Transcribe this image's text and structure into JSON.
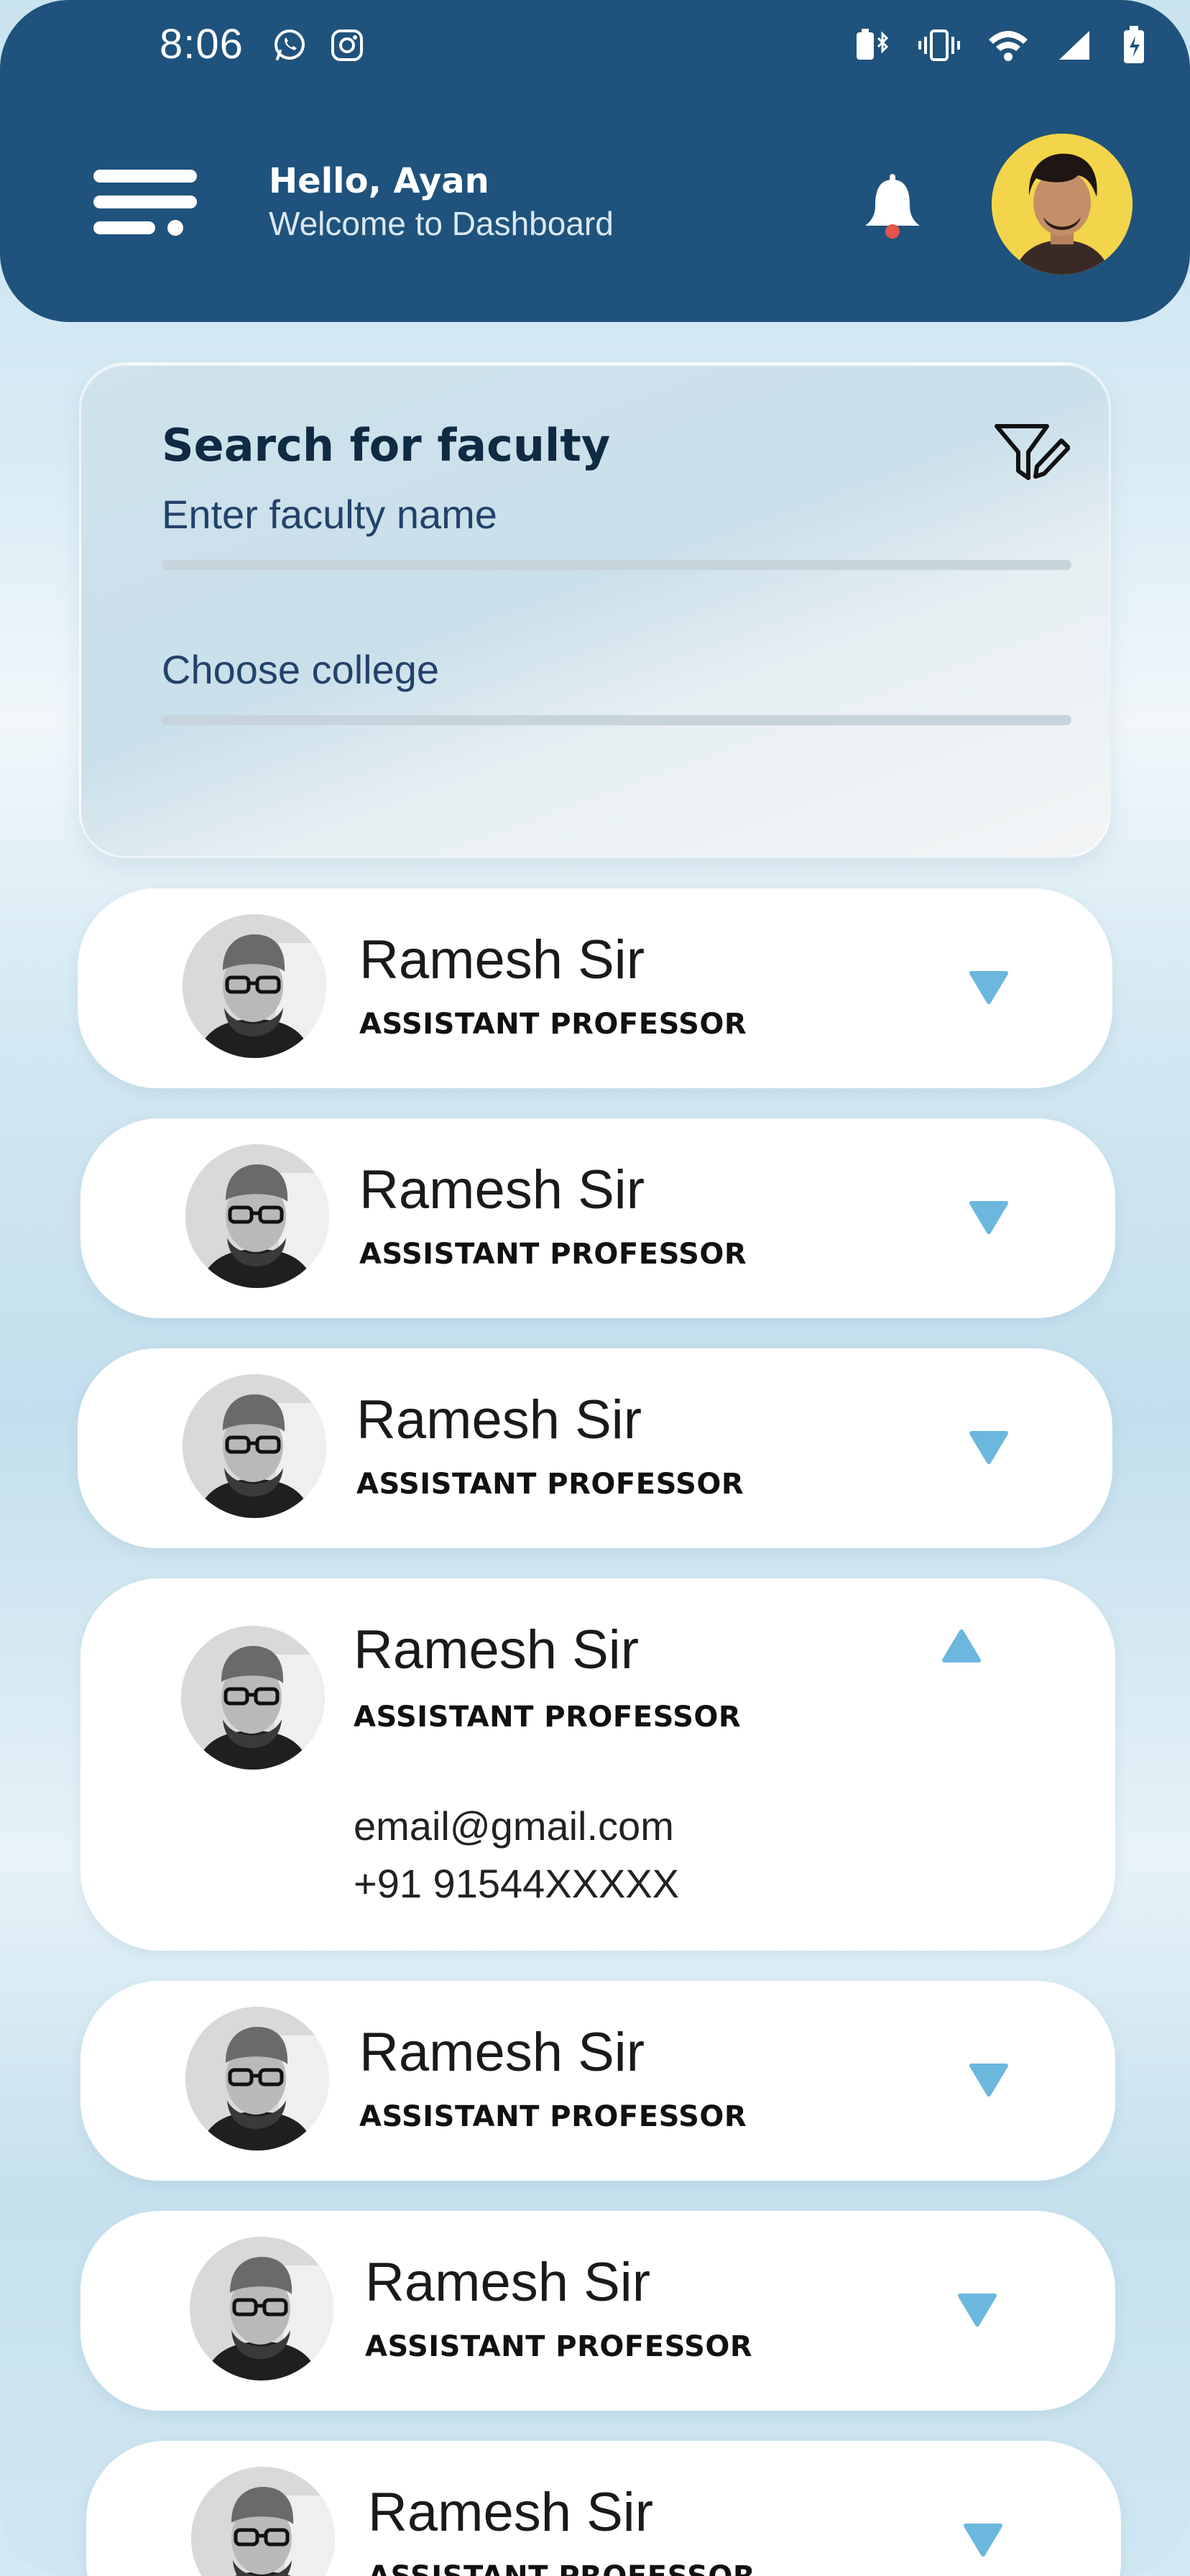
{
  "status_bar": {
    "time": "8:06"
  },
  "header": {
    "greeting": "Hello, Ayan",
    "subtitle": "Welcome to Dashboard"
  },
  "search": {
    "title": "Search for faculty",
    "name_placeholder": "Enter faculty name",
    "college_placeholder": "Choose college"
  },
  "faculty": [
    {
      "name": "Ramesh Sir",
      "role": "ASSISTANT PROFESSOR",
      "expanded": false
    },
    {
      "name": "Ramesh Sir",
      "role": "ASSISTANT PROFESSOR",
      "expanded": false
    },
    {
      "name": "Ramesh Sir",
      "role": "ASSISTANT PROFESSOR",
      "expanded": false
    },
    {
      "name": "Ramesh Sir",
      "role": "ASSISTANT PROFESSOR",
      "expanded": true,
      "email": "email@gmail.com",
      "phone": "+91 91544XXXXX"
    },
    {
      "name": "Ramesh Sir",
      "role": "ASSISTANT PROFESSOR",
      "expanded": false
    },
    {
      "name": "Ramesh Sir",
      "role": "ASSISTANT PROFESSOR",
      "expanded": false
    },
    {
      "name": "Ramesh Sir",
      "role": "ASSISTANT PROFESSOR",
      "expanded": false
    }
  ],
  "icons": {
    "menu": "menu-icon",
    "bell": "bell-icon",
    "filter": "filter-edit-icon",
    "expand": "triangle-down-icon",
    "collapse": "triangle-up-icon"
  },
  "colors": {
    "header": "#1f527c",
    "accent": "#6bb7de",
    "notification_dot": "#e4554a",
    "avatar_bg": "#f2d54a"
  }
}
